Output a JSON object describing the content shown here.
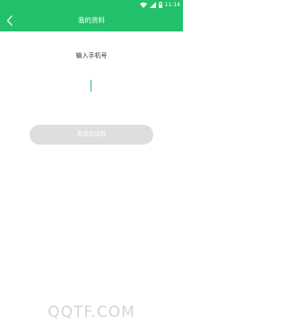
{
  "status_bar": {
    "time": "11:14",
    "icons": [
      "wifi-icon",
      "signal-icon",
      "battery-icon"
    ]
  },
  "nav": {
    "title": "我的资料",
    "back_icon": "chevron-left-icon"
  },
  "form": {
    "prompt": "输入手机号",
    "phone_value": "",
    "submit_label": "发送验证码"
  },
  "watermark": "QQTF.COM",
  "colors": {
    "accent": "#23c16b",
    "button_disabled": "#dedede",
    "watermark": "#d4d4d4"
  }
}
